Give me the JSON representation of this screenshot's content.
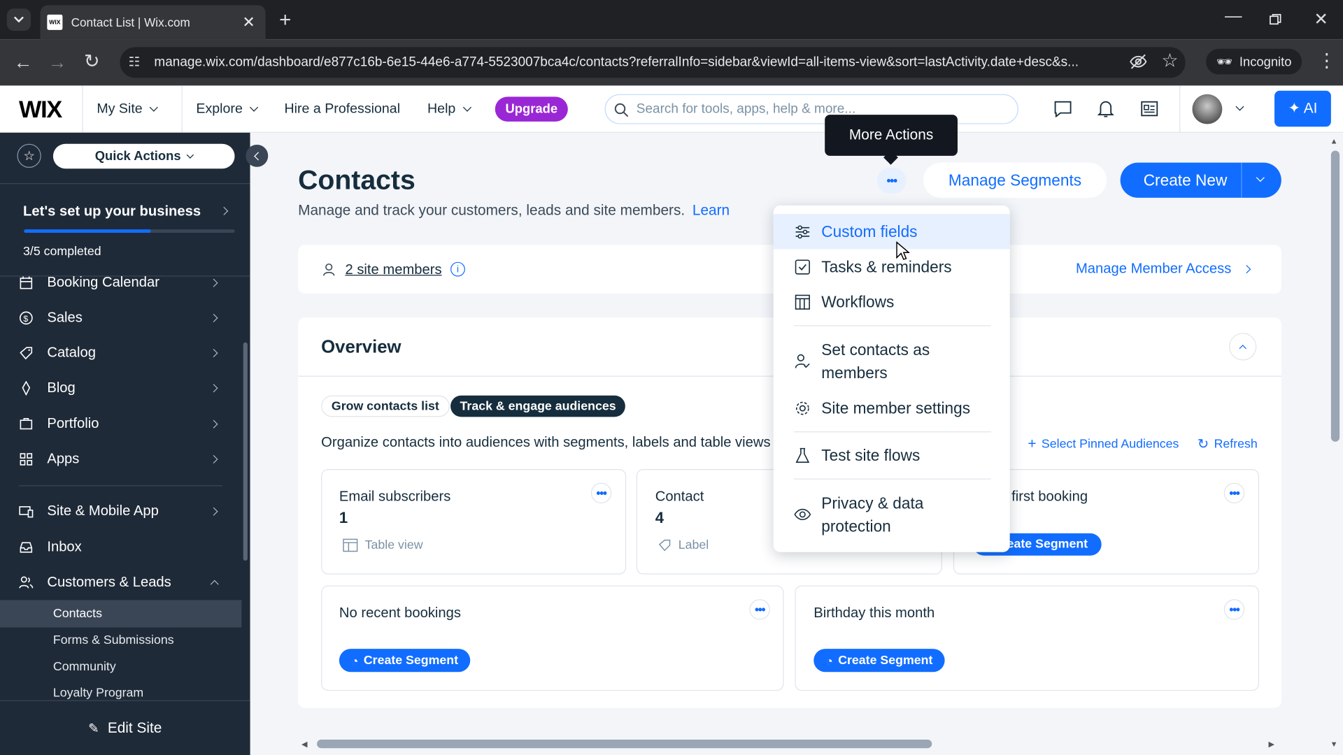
{
  "browser": {
    "tab_title": "Contact List | Wix.com",
    "tab_favicon": "WIX",
    "url": "manage.wix.com/dashboard/e877c16b-6e15-44e6-a774-5523007bca4c/contacts?referralInfo=sidebar&viewId=all-items-view&sort=lastActivity.date+desc&s...",
    "incognito_label": "Incognito"
  },
  "header": {
    "logo": "WIX",
    "my_site": "My Site",
    "explore": "Explore",
    "hire": "Hire a Professional",
    "help": "Help",
    "upgrade": "Upgrade",
    "search_placeholder": "Search for tools, apps, help & more...",
    "ai_label": "AI",
    "brand_color": "#116dff",
    "upgrade_color": "#9a27d5"
  },
  "sidebar": {
    "quick_actions": "Quick Actions",
    "setup_title": "Let's set up your business",
    "setup_progress_text": "3/5 completed",
    "setup_progress_fraction": 0.6,
    "items": [
      {
        "label": "Booking Calendar"
      },
      {
        "label": "Sales"
      },
      {
        "label": "Catalog"
      },
      {
        "label": "Blog"
      },
      {
        "label": "Portfolio"
      },
      {
        "label": "Apps"
      },
      {
        "label": "Site & Mobile App"
      },
      {
        "label": "Inbox"
      },
      {
        "label": "Customers & Leads"
      }
    ],
    "sub_items": [
      {
        "label": "Contacts"
      },
      {
        "label": "Forms & Submissions"
      },
      {
        "label": "Community"
      },
      {
        "label": "Loyalty Program"
      }
    ],
    "edit_site": "Edit Site"
  },
  "page": {
    "title": "Contacts",
    "subtitle": "Manage and track your customers, leads and site members.",
    "learn_link": "Learn",
    "tooltip": "More Actions",
    "manage_segments": "Manage Segments",
    "create_new": "Create New",
    "members_link": "2 site members",
    "manage_member_access": "Manage Member Access"
  },
  "overview": {
    "title": "Overview",
    "tabs": [
      {
        "label": "Grow contacts list",
        "selected": false
      },
      {
        "label": "Track & engage audiences",
        "selected": true
      }
    ],
    "description": "Organize contacts into audiences with segments, labels and table views",
    "select_pinned": "Select Pinned Audiences",
    "refresh": "Refresh",
    "cards_row1": [
      {
        "title": "Email subscribers",
        "count": "1",
        "tag": "Table view"
      },
      {
        "title": "Contact",
        "count": "4",
        "tag": "Label"
      },
      {
        "title": "first booking",
        "button": "eate Segment"
      }
    ],
    "cards_row2": [
      {
        "title": "No recent bookings",
        "button": "Create Segment"
      },
      {
        "title": "Birthday this month",
        "button": "Create Segment"
      }
    ]
  },
  "more_actions_menu": {
    "items": [
      {
        "label": "Custom fields",
        "icon": "sliders-icon"
      },
      {
        "label": "Tasks & reminders",
        "icon": "checkbox-icon"
      },
      {
        "label": "Workflows",
        "icon": "table-icon"
      },
      {
        "label": "Set contacts as members",
        "icon": "person-check-icon"
      },
      {
        "label": "Site member settings",
        "icon": "gear-icon"
      },
      {
        "label": "Test site flows",
        "icon": "flask-icon"
      },
      {
        "label": "Privacy & data protection",
        "icon": "eye-icon"
      }
    ]
  }
}
